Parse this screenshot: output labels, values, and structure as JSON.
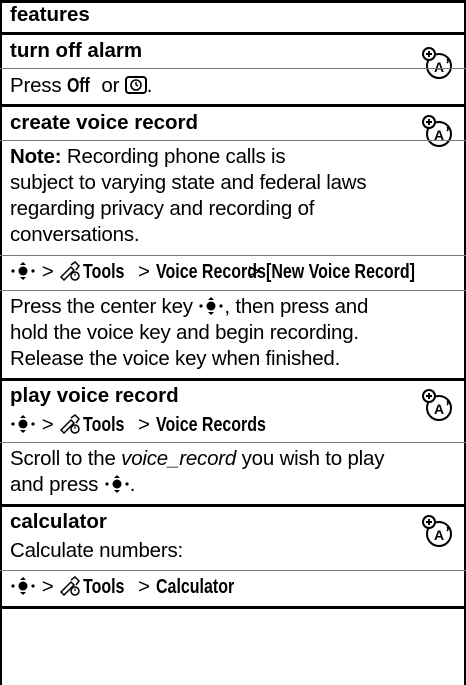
{
  "table": {
    "header": "features",
    "sections": [
      {
        "title": "turn off alarm",
        "body_prefix": "Press ",
        "key_off": "Off",
        "body_or": " or ",
        "body_suffix": "."
      },
      {
        "title": "create voice record",
        "note_label": "Note:",
        "note_lines": [
          " Recording phone calls is",
          "subject to varying state and federal laws",
          "regarding privacy and recording of",
          "conversations."
        ],
        "path": {
          "sep": ">",
          "tools": "Tools",
          "voice_records": "Voice Records",
          "new_record": "[New Voice Record]"
        },
        "instr_line1_a": "Press the center key ",
        "instr_line1_b": ", then press and",
        "instr_lines": [
          "hold the voice key and begin recording.",
          "Release the voice key when finished."
        ]
      },
      {
        "title": "play voice record",
        "path": {
          "sep": ">",
          "tools": "Tools",
          "voice_records": "Voice Records"
        },
        "scroll_a": "Scroll to the ",
        "scroll_italic": "voice_record",
        "scroll_b": " you wish to play",
        "scroll_line2": "and press ",
        "scroll_end": "."
      },
      {
        "title": "calculator",
        "body": "Calculate numbers:",
        "path": {
          "sep": ">",
          "tools": "Tools",
          "calculator": "Calculator"
        }
      }
    ]
  }
}
